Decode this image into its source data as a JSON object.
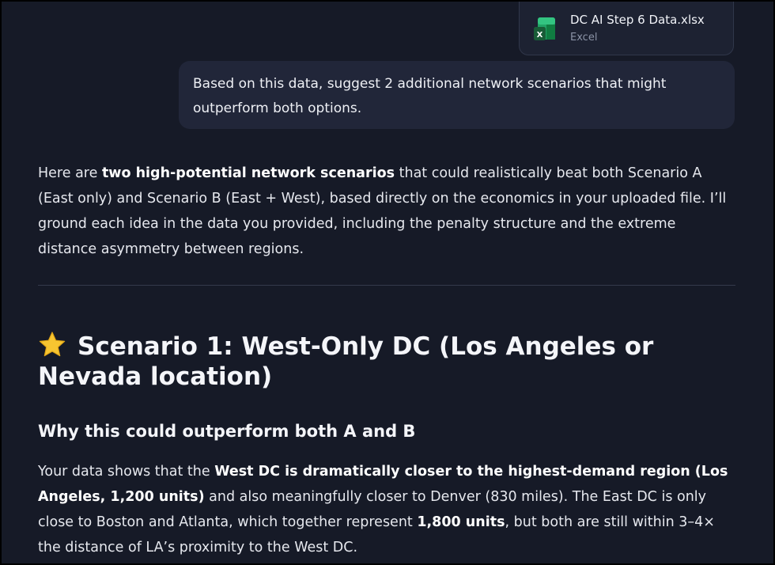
{
  "attachment": {
    "file_name": "DC AI Step 6 Data.xlsx",
    "file_type": "Excel",
    "icon": "excel-file-icon"
  },
  "user_message": "Based on this data, suggest 2 additional network scenarios that might outperform both options.",
  "response": {
    "intro": {
      "t1": "Here are ",
      "b1": "two high-potential network scenarios",
      "t2": " that could realistically beat both Scenario A (East only) and Scenario B (East + West), based directly on the economics in your uploaded file. I’ll ground each idea in the data you provided, including the penalty structure and the extreme distance asymmetry between regions."
    },
    "scenario1_heading": "Scenario 1: West-Only DC (Los Angeles or Nevada location)",
    "scenario1_icon": "star-icon",
    "why_heading": "Why this could outperform both A and B",
    "body": {
      "t1": "Your data shows that the ",
      "b1": "West DC is dramatically closer to the highest-demand region (Los Angeles, 1,200 units)",
      "t2": " and also meaningfully closer to Denver (830 miles). The East DC is only close to Boston and Atlanta, which together represent ",
      "b2": "1,800 units",
      "t3": ", but both are still within 3–4× the distance of LA’s proximity to the West DC."
    }
  }
}
